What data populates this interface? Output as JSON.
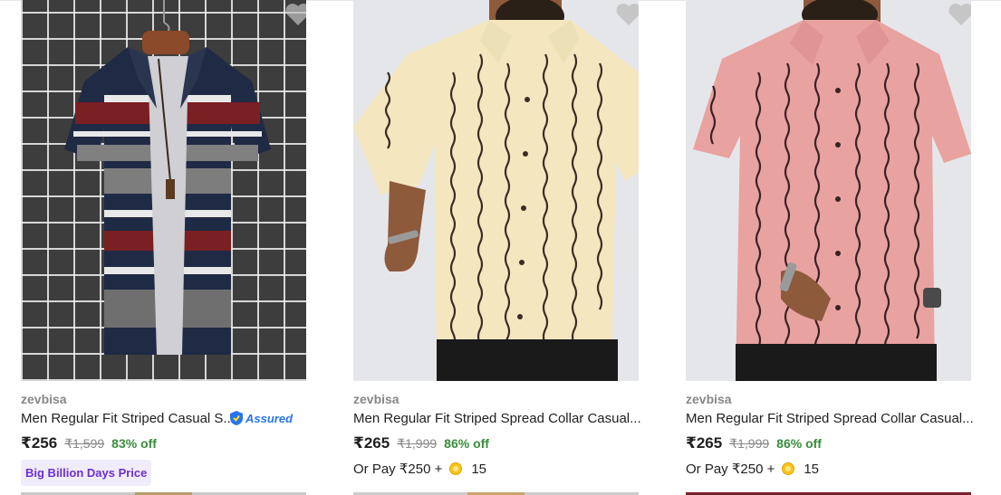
{
  "products": [
    {
      "brand": "zevbisa",
      "title": "Men Regular Fit Striped Casual S...",
      "assured_label": "Assured",
      "price": "₹256",
      "mrp": "₹1,599",
      "discount": "83% off",
      "badge": "Big Billion Days Price",
      "wishlist_icon": "heart-icon"
    },
    {
      "brand": "zevbisa",
      "title": "Men Regular Fit Striped Spread Collar Casual...",
      "price": "₹265",
      "mrp": "₹1,999",
      "discount": "86% off",
      "or_pay": "Or Pay ₹250 +",
      "coins": "15",
      "wishlist_icon": "heart-icon"
    },
    {
      "brand": "zevbisa",
      "title": "Men Regular Fit Striped Spread Collar Casual...",
      "price": "₹265",
      "mrp": "₹1,999",
      "discount": "86% off",
      "or_pay": "Or Pay ₹250 +",
      "coins": "15",
      "wishlist_icon": "heart-icon"
    }
  ],
  "colors": {
    "accent_green": "#388e3c",
    "badge_purple": "#6b2fd4",
    "assured_blue": "#2874f0",
    "muted": "#878787"
  }
}
